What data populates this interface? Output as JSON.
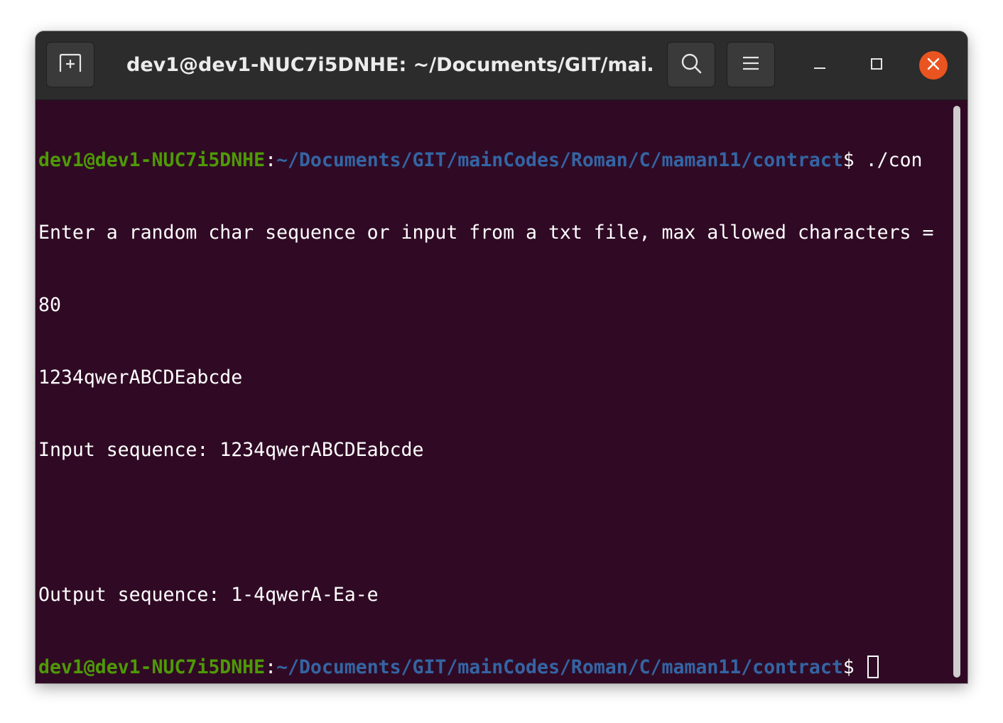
{
  "window": {
    "title": "dev1@dev1-NUC7i5DNHE: ~/Documents/GIT/mai…"
  },
  "icons": {
    "new_tab": "new-tab-icon",
    "search": "search-icon",
    "menu": "hamburger-menu-icon",
    "minimize": "minimize-icon",
    "maximize": "maximize-icon",
    "close": "close-icon"
  },
  "colors": {
    "terminal_bg": "#300a24",
    "titlebar_bg": "#2c2c2c",
    "prompt_user": "#4e9a06",
    "prompt_path": "#3465a4",
    "close_button": "#e95420"
  },
  "terminal": {
    "prompt1": {
      "user_host": "dev1@dev1-NUC7i5DNHE",
      "colon": ":",
      "path": "~/Documents/GIT/mainCodes/Roman/C/maman11/contract",
      "dollar": "$ ",
      "command": "./con"
    },
    "lines": [
      "Enter a random char sequence or input from a txt file, max allowed characters =",
      "80",
      "1234qwerABCDEabcde",
      "Input sequence: 1234qwerABCDEabcde",
      "",
      "Output sequence: 1-4qwerA-Ea-e"
    ],
    "prompt2": {
      "user_host": "dev1@dev1-NUC7i5DNHE",
      "colon": ":",
      "path": "~/Documents/GIT/mainCodes/Roman/C/maman11/contract",
      "dollar": "$ "
    }
  }
}
